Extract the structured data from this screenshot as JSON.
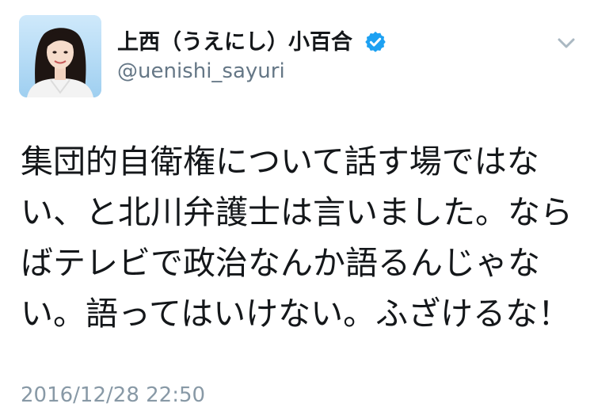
{
  "tweet": {
    "author": {
      "display_name": "上西（うえにし）小百合",
      "handle": "@uenishi_sayuri",
      "verified": true,
      "avatar_icon": "profile-photo"
    },
    "text": "集団的自衛権について話す場ではない、と北川弁護士は言いました。ならばテレビで政治なんか語るんじゃない。語ってはいけない。ふざけるな！",
    "timestamp": "2016/12/28 22:50"
  },
  "icons": {
    "verified": "verified-badge-icon",
    "menu": "chevron-down-icon"
  },
  "colors": {
    "text": "#14171a",
    "secondary": "#657786",
    "timestamp": "#8899a6",
    "verified": "#1da1f2"
  }
}
